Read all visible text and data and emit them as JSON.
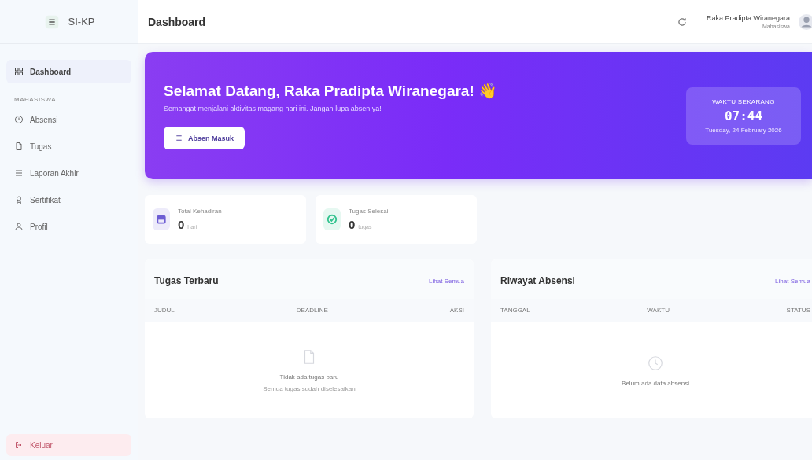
{
  "sidebar": {
    "logo": "SI-KP",
    "items": [
      {
        "kind": "item",
        "label": "Dashboard",
        "selected": true
      },
      {
        "kind": "section",
        "label": "MAHASISWA"
      },
      {
        "kind": "item",
        "label": "Absensi",
        "selected": false
      },
      {
        "kind": "item",
        "label": "Tugas",
        "selected": false
      },
      {
        "kind": "item",
        "label": "Laporan Akhir",
        "selected": false
      },
      {
        "kind": "item",
        "label": "Sertifikat",
        "selected": false
      },
      {
        "kind": "item",
        "label": "Profil",
        "selected": false
      }
    ],
    "logout": "Keluar"
  },
  "header": {
    "title": "Dashboard",
    "user": {
      "name": "Raka Pradipta Wiranegara",
      "role": "Mahasiswa"
    }
  },
  "banner": {
    "title": "Selamat Datang, Raka Pradipta Wiranegara! 👋",
    "subtitle": "Semangat menjalani aktivitas magang hari ini. Jangan lupa absen ya!",
    "button": "Absen Masuk",
    "clock": {
      "label": "WAKTU SEKARANG",
      "time": "07:44",
      "date": "Tuesday, 24 February 2026"
    }
  },
  "stats": [
    {
      "label": "Total Kehadiran",
      "value": "0",
      "unit": "hari",
      "color": "#6d5dd3"
    },
    {
      "label": "Tugas Selesai",
      "value": "0",
      "unit": "tugas",
      "color": "#34c38f"
    }
  ],
  "panels": [
    {
      "title": "Tugas Terbaru",
      "link": "Lihat Semua",
      "columns": [
        "JUDUL",
        "DEADLINE",
        "AKSI"
      ],
      "empty_title": "Tidak ada tugas baru",
      "empty_subtitle": "Semua tugas sudah diselesaikan"
    },
    {
      "title": "Riwayat Absensi",
      "link": "Lihat Semua",
      "columns": [
        "TANGGAL",
        "WAKTU",
        "STATUS"
      ],
      "empty_title": "Belum ada data absensi"
    }
  ]
}
